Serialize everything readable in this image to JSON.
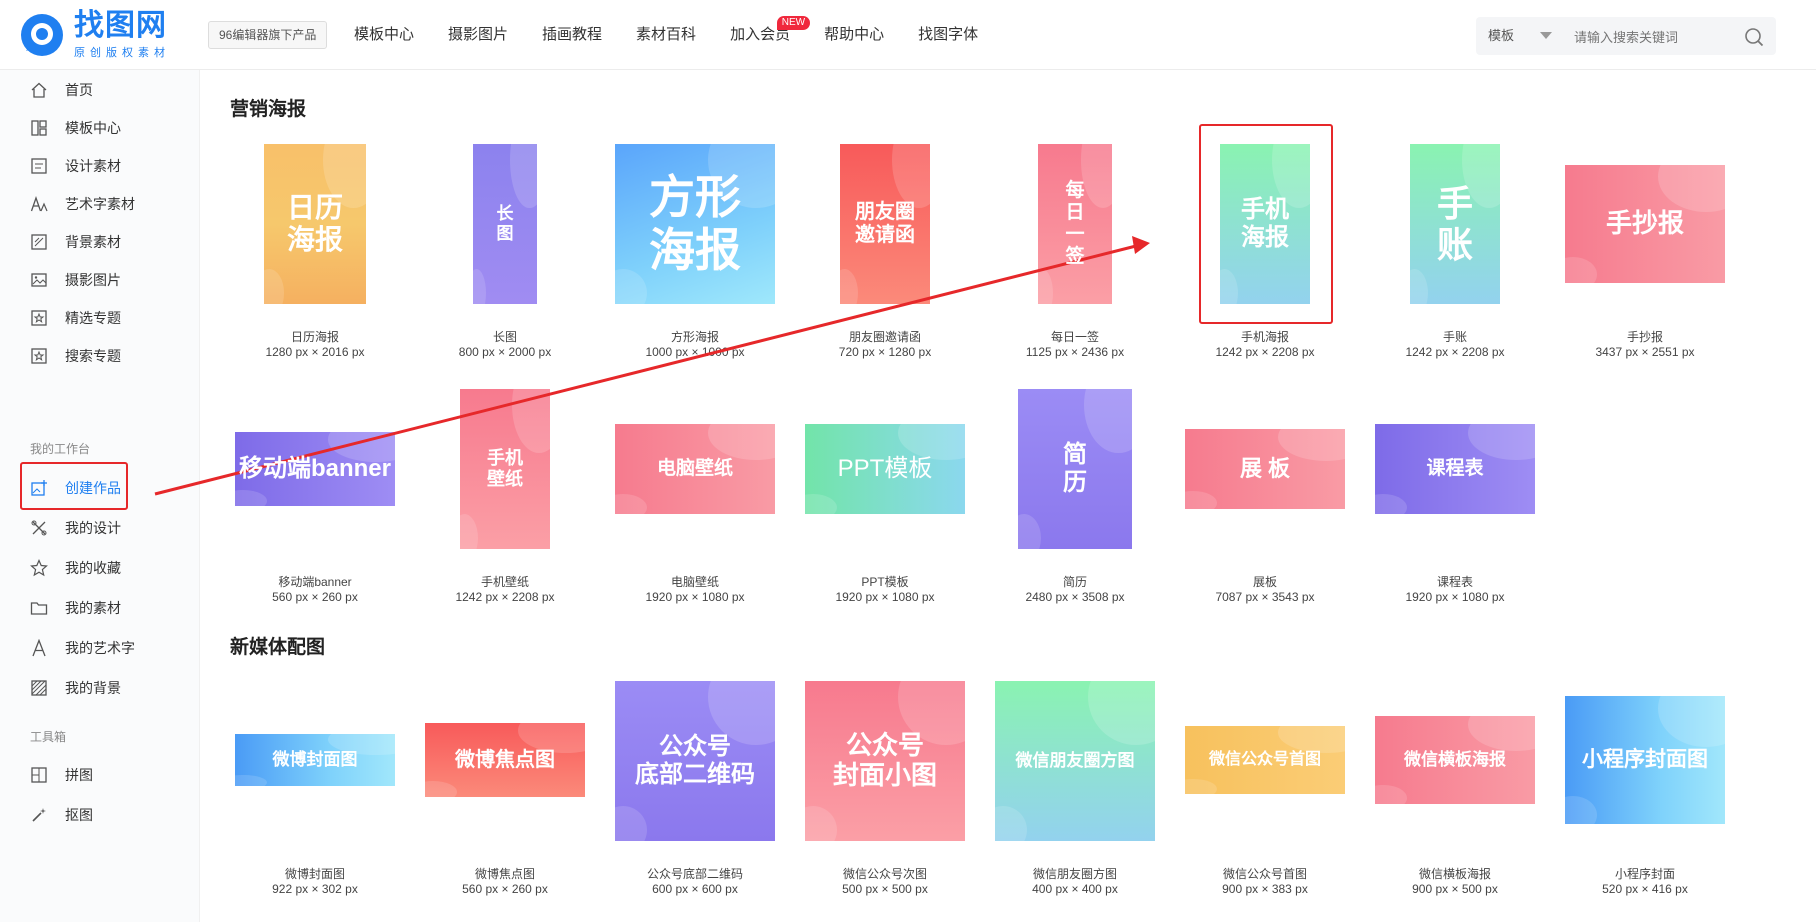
{
  "header": {
    "logo_title": "找图网",
    "logo_sub": "原创版权素材",
    "tag": "96编辑器旗下产品",
    "nav": [
      {
        "label": "模板中心"
      },
      {
        "label": "摄影图片"
      },
      {
        "label": "插画教程"
      },
      {
        "label": "素材百科"
      },
      {
        "label": "加入会员",
        "badge": "NEW"
      },
      {
        "label": "帮助中心"
      },
      {
        "label": "找图字体"
      }
    ],
    "search_type": "模板",
    "search_placeholder": "请输入搜索关键词"
  },
  "sidebar": {
    "items": [
      {
        "label": "首页",
        "icon": "home-icon"
      },
      {
        "label": "模板中心",
        "icon": "template-icon"
      },
      {
        "label": "设计素材",
        "icon": "design-material-icon"
      },
      {
        "label": "艺术字素材",
        "icon": "art-text-icon"
      },
      {
        "label": "背景素材",
        "icon": "background-icon"
      },
      {
        "label": "摄影图片",
        "icon": "photo-icon"
      },
      {
        "label": "精选专题",
        "icon": "star-box-icon"
      },
      {
        "label": "搜索专题",
        "icon": "star-box-icon"
      }
    ],
    "workspace_title": "我的工作台",
    "workspace": [
      {
        "label": "创建作品",
        "icon": "create-work-icon"
      },
      {
        "label": "我的设计",
        "icon": "my-design-icon"
      },
      {
        "label": "我的收藏",
        "icon": "star-icon"
      },
      {
        "label": "我的素材",
        "icon": "folder-icon"
      },
      {
        "label": "我的艺术字",
        "icon": "letter-a-icon"
      },
      {
        "label": "我的背景",
        "icon": "background-pattern-icon"
      }
    ],
    "tools_title": "工具箱",
    "tools": [
      {
        "label": "拼图",
        "icon": "collage-icon"
      },
      {
        "label": "抠图",
        "icon": "magic-wand-icon"
      }
    ]
  },
  "sections": [
    {
      "title": "营销海报",
      "cards": [
        {
          "name": "日历海报",
          "size": "1280 px × 2016 px",
          "thumb": "日历\n海报",
          "style": "g-orange"
        },
        {
          "name": "长图",
          "size": "800 px × 2000 px",
          "thumb": "长\n图",
          "style": "g-purple"
        },
        {
          "name": "方形海报",
          "size": "1000 px × 1000 px",
          "thumb": "方形\n海报",
          "style": "g-blue"
        },
        {
          "name": "朋友圈邀请函",
          "size": "720 px × 1280 px",
          "thumb": "朋友圈\n邀请函",
          "style": "g-red"
        },
        {
          "name": "每日一签",
          "size": "1125 px × 2436 px",
          "thumb": "每\n日\n一\n签",
          "style": "g-pink"
        },
        {
          "name": "手机海报",
          "size": "1242 px × 2208 px",
          "thumb": "手机\n海报",
          "style": "g-green"
        },
        {
          "name": "手账",
          "size": "1242 px × 2208 px",
          "thumb": "手\n账",
          "style": "g-green"
        },
        {
          "name": "手抄报",
          "size": "3437 px × 2551 px",
          "thumb": "手抄报",
          "style": "g-pinkr"
        },
        {
          "name": "移动端banner",
          "size": "560 px × 260 px",
          "thumb": "移动端banner",
          "style": "g-violet"
        },
        {
          "name": "手机壁纸",
          "size": "1242 px × 2208 px",
          "thumb": "手机\n壁纸",
          "style": "g-pink"
        },
        {
          "name": "电脑壁纸",
          "size": "1920 px × 1080 px",
          "thumb": "电脑壁纸",
          "style": "g-pinkr"
        },
        {
          "name": "PPT模板",
          "size": "1920 px × 1080 px",
          "thumb": "PPT模板",
          "style": "g-teal"
        },
        {
          "name": "简历",
          "size": "2480 px × 3508 px",
          "thumb": "简\n历",
          "style": "g-lpurp"
        },
        {
          "name": "展板",
          "size": "7087 px × 3543 px",
          "thumb": "展 板",
          "style": "g-pinkr"
        },
        {
          "name": "课程表",
          "size": "1920 px × 1080 px",
          "thumb": "课程表",
          "style": "g-violet"
        }
      ]
    },
    {
      "title": "新媒体配图",
      "cards": [
        {
          "name": "微博封面图",
          "size": "922 px × 302 px",
          "thumb": "微博封面图",
          "style": "g-cblue"
        },
        {
          "name": "微博焦点图",
          "size": "560 px × 260 px",
          "thumb": "微博焦点图",
          "style": "g-red"
        },
        {
          "name": "公众号底部二维码",
          "size": "600 px × 600 px",
          "thumb": "公众号\n底部二维码",
          "style": "g-lpurp"
        },
        {
          "name": "微信公众号次图",
          "size": "500 px × 500 px",
          "thumb": "公众号\n封面小图",
          "style": "g-pink"
        },
        {
          "name": "微信朋友圈方图",
          "size": "400 px × 400 px",
          "thumb": "微信朋友圈方图",
          "style": "g-green"
        },
        {
          "name": "微信公众号首图",
          "size": "900 px × 383 px",
          "thumb": "微信公众号首图",
          "style": "g-yellow"
        },
        {
          "name": "微信横板海报",
          "size": "900 px × 500 px",
          "thumb": "微信横板海报",
          "style": "g-pinkr"
        },
        {
          "name": "小程序封面",
          "size": "520 px × 416 px",
          "thumb": "小程序封面图",
          "style": "g-cblue"
        }
      ]
    }
  ],
  "colors": {
    "brand": "#1f7ff0",
    "annotation_red": "#e6282a",
    "badge_red": "#f0283c"
  }
}
